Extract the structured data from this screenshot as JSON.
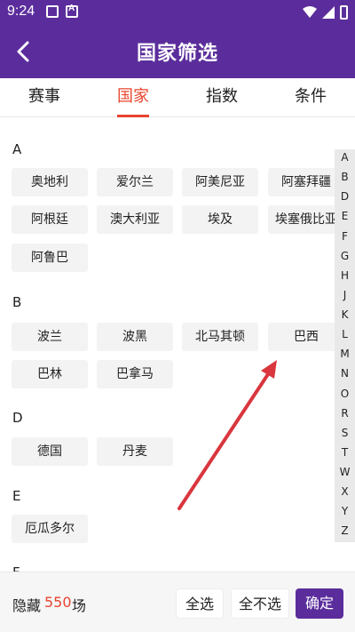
{
  "status_bar": {
    "time": "9:24"
  },
  "app_bar": {
    "title": "国家筛选"
  },
  "tabs": [
    {
      "label": "赛事"
    },
    {
      "label": "国家"
    },
    {
      "label": "指数"
    },
    {
      "label": "条件"
    }
  ],
  "sections": [
    {
      "letter": "A",
      "countries": [
        "奥地利",
        "爱尔兰",
        "阿美尼亚",
        "阿塞拜疆",
        "阿根廷",
        "澳大利亚",
        "埃及",
        "埃塞俄比亚",
        "阿鲁巴"
      ]
    },
    {
      "letter": "B",
      "countries": [
        "波兰",
        "波黑",
        "北马其顿",
        "巴西",
        "巴林",
        "巴拿马"
      ]
    },
    {
      "letter": "D",
      "countries": [
        "德国",
        "丹麦"
      ]
    },
    {
      "letter": "E",
      "countries": [
        "厄瓜多尔"
      ]
    },
    {
      "letter": "F",
      "countries": []
    }
  ],
  "index_letters": [
    "A",
    "B",
    "D",
    "E",
    "F",
    "G",
    "H",
    "J",
    "K",
    "L",
    "M",
    "N",
    "O",
    "R",
    "S",
    "T",
    "W",
    "X",
    "Y",
    "Z"
  ],
  "footer": {
    "hidden_label": "隐藏",
    "hidden_count": "550",
    "hidden_unit": "场",
    "select_all": "全选",
    "select_none": "全不选",
    "confirm": "确定"
  }
}
